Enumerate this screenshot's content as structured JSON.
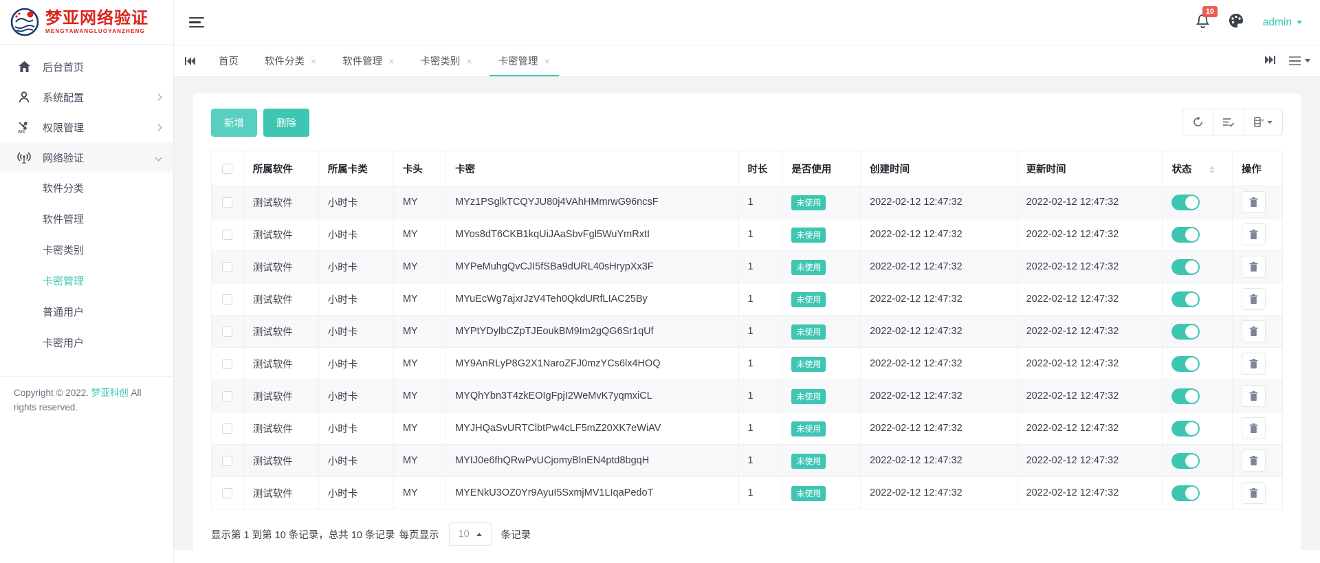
{
  "colors": {
    "accent": "#3fc6b2",
    "danger": "#ee5b50",
    "logo_red": "#d9261c"
  },
  "sidebar": {
    "logo_title": "梦亚网络验证",
    "logo_subtitle": "MENGYAWANGLUOYANZHENG",
    "items": [
      {
        "label": "后台首页"
      },
      {
        "label": "系统配置"
      },
      {
        "label": "权限管理"
      },
      {
        "label": "网络验证"
      }
    ],
    "subitems": [
      {
        "label": "软件分类"
      },
      {
        "label": "软件管理"
      },
      {
        "label": "卡密类别"
      },
      {
        "label": "卡密管理"
      },
      {
        "label": "普通用户"
      },
      {
        "label": "卡密用户"
      }
    ],
    "copyright_prefix": "Copyright © 2022.",
    "copyright_brand": "梦亚科创",
    "copyright_suffix": "All rights reserved."
  },
  "topbar": {
    "notification_count": "10",
    "username": "admin"
  },
  "tabbar": {
    "tabs": [
      {
        "label": "首页"
      },
      {
        "label": "软件分类"
      },
      {
        "label": "软件管理"
      },
      {
        "label": "卡密类别"
      },
      {
        "label": "卡密管理"
      }
    ]
  },
  "actions": {
    "add": "新增",
    "delete": "删除"
  },
  "table": {
    "headers": [
      "所属软件",
      "所属卡类",
      "卡头",
      "卡密",
      "时长",
      "是否使用",
      "创建时间",
      "更新时间",
      "状态",
      "操作"
    ],
    "rows": [
      {
        "software": "测试软件",
        "card_type": "小时卡",
        "prefix": "MY",
        "key": "MYz1PSglkTCQYJU80j4VAhHMmrwG96ncsF",
        "duration": "1",
        "used": "未使用",
        "created": "2022-02-12 12:47:32",
        "updated": "2022-02-12 12:47:32"
      },
      {
        "software": "测试软件",
        "card_type": "小时卡",
        "prefix": "MY",
        "key": "MYos8dT6CKB1kqUiJAaSbvFgl5WuYmRxtI",
        "duration": "1",
        "used": "未使用",
        "created": "2022-02-12 12:47:32",
        "updated": "2022-02-12 12:47:32"
      },
      {
        "software": "测试软件",
        "card_type": "小时卡",
        "prefix": "MY",
        "key": "MYPeMuhgQvCJI5fSBa9dURL40sHrypXx3F",
        "duration": "1",
        "used": "未使用",
        "created": "2022-02-12 12:47:32",
        "updated": "2022-02-12 12:47:32"
      },
      {
        "software": "测试软件",
        "card_type": "小时卡",
        "prefix": "MY",
        "key": "MYuEcWg7ajxrJzV4Teh0QkdURfLIAC25By",
        "duration": "1",
        "used": "未使用",
        "created": "2022-02-12 12:47:32",
        "updated": "2022-02-12 12:47:32"
      },
      {
        "software": "测试软件",
        "card_type": "小时卡",
        "prefix": "MY",
        "key": "MYPtYDylbCZpTJEoukBM9Im2gQG6Sr1qUf",
        "duration": "1",
        "used": "未使用",
        "created": "2022-02-12 12:47:32",
        "updated": "2022-02-12 12:47:32"
      },
      {
        "software": "测试软件",
        "card_type": "小时卡",
        "prefix": "MY",
        "key": "MY9AnRLyP8G2X1NaroZFJ0mzYCs6lx4HOQ",
        "duration": "1",
        "used": "未使用",
        "created": "2022-02-12 12:47:32",
        "updated": "2022-02-12 12:47:32"
      },
      {
        "software": "测试软件",
        "card_type": "小时卡",
        "prefix": "MY",
        "key": "MYQhYbn3T4zkEOIgFpjI2WeMvK7yqmxiCL",
        "duration": "1",
        "used": "未使用",
        "created": "2022-02-12 12:47:32",
        "updated": "2022-02-12 12:47:32"
      },
      {
        "software": "测试软件",
        "card_type": "小时卡",
        "prefix": "MY",
        "key": "MYJHQaSvURTClbtPw4cLF5mZ20XK7eWiAV",
        "duration": "1",
        "used": "未使用",
        "created": "2022-02-12 12:47:32",
        "updated": "2022-02-12 12:47:32"
      },
      {
        "software": "测试软件",
        "card_type": "小时卡",
        "prefix": "MY",
        "key": "MYIJ0e6fhQRwPvUCjomyBlnEN4ptd8bgqH",
        "duration": "1",
        "used": "未使用",
        "created": "2022-02-12 12:47:32",
        "updated": "2022-02-12 12:47:32"
      },
      {
        "software": "测试软件",
        "card_type": "小时卡",
        "prefix": "MY",
        "key": "MYENkU3OZ0Yr9AyuI5SxmjMV1LIqaPedoT",
        "duration": "1",
        "used": "未使用",
        "created": "2022-02-12 12:47:32",
        "updated": "2022-02-12 12:47:32"
      }
    ]
  },
  "pagination": {
    "summary": "显示第 1 到第 10 条记录，总共 10 条记录",
    "per_page_label": "每页显示",
    "page_size": "10",
    "unit_label": "条记录"
  }
}
